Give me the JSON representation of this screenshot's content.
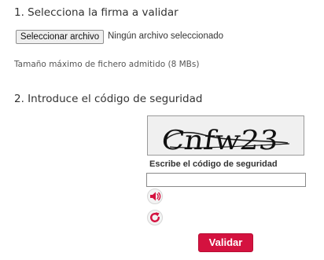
{
  "step1": {
    "title": "1. Selecciona la firma a validar",
    "file_button_label": "Seleccionar archivo",
    "file_status": "Ningún archivo seleccionado",
    "max_size_text": "Tamaño máximo de fichero admitido (8 MBs)"
  },
  "step2": {
    "title": "2. Introduce el código de seguridad",
    "captcha_image_text": "Cnfw23",
    "captcha_label": "Escribe el código de seguridad",
    "captcha_input_value": "",
    "audio_icon": "speaker-icon",
    "refresh_icon": "refresh-icon"
  },
  "actions": {
    "validate_label": "Validar"
  },
  "colors": {
    "primary_button": "#d4123f",
    "icon_red": "#d4123f"
  }
}
